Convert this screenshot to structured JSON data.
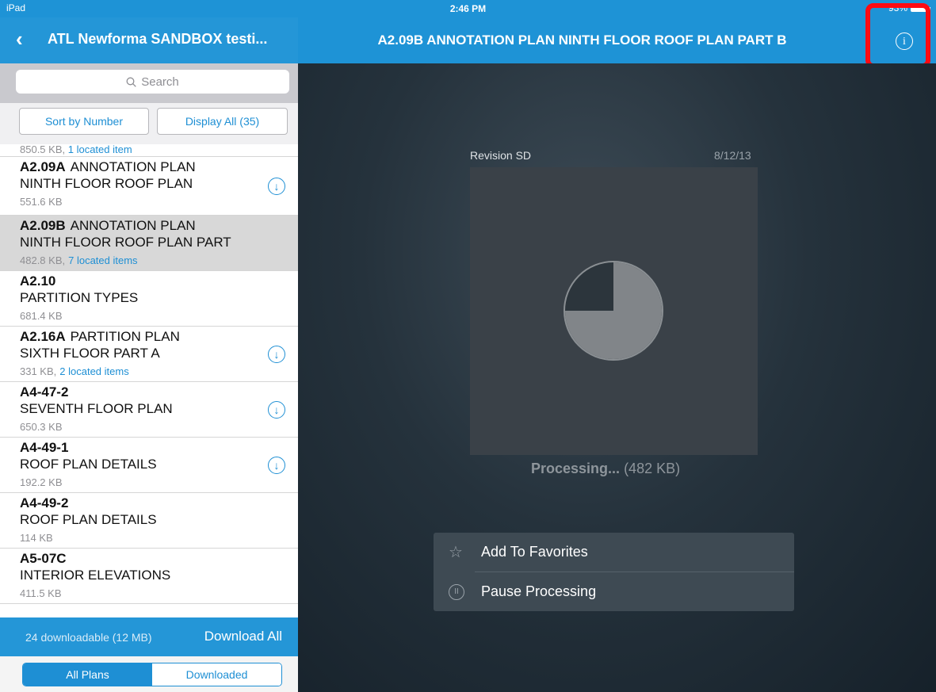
{
  "status": {
    "carrier": "iPad",
    "time": "2:46 PM",
    "battery": "93%"
  },
  "nav": {
    "back_icon": "chevron-left-icon",
    "project_title": "ATL Newforma SANDBOX testi...",
    "sheet_title": "A2.09B ANNOTATION PLAN NINTH FLOOR ROOF PLAN PART B",
    "info_icon": "i"
  },
  "search": {
    "placeholder": "Search"
  },
  "filters": {
    "sort_label": "Sort by Number",
    "display_label": "Display All (35)"
  },
  "list": {
    "partial_meta": {
      "size": "850.5 KB,",
      "located": "1 located item"
    },
    "items": [
      {
        "code": "A2.09A",
        "name_line1": "ANNOTATION PLAN",
        "name_line2": "NINTH FLOOR ROOF PLAN",
        "size": "551.6 KB",
        "located": "",
        "download": true,
        "selected": false
      },
      {
        "code": "A2.09B",
        "name_line1": "ANNOTATION PLAN",
        "name_line2": "NINTH FLOOR ROOF PLAN PART",
        "size": "482.8 KB,",
        "located": "7 located items",
        "download": false,
        "selected": true
      },
      {
        "code": "A2.10",
        "name_line1": "",
        "name_line2": "PARTITION TYPES",
        "size": "681.4 KB",
        "located": "",
        "download": false,
        "selected": false
      },
      {
        "code": "A2.16A",
        "name_line1": "PARTITION PLAN",
        "name_line2": "SIXTH FLOOR PART A",
        "size": "331 KB,",
        "located": "2 located items",
        "download": true,
        "selected": false
      },
      {
        "code": "A4-47-2",
        "name_line1": "",
        "name_line2": "SEVENTH FLOOR PLAN",
        "size": "650.3 KB",
        "located": "",
        "download": true,
        "selected": false
      },
      {
        "code": "A4-49-1",
        "name_line1": "",
        "name_line2": "ROOF PLAN DETAILS",
        "size": "192.2 KB",
        "located": "",
        "download": true,
        "selected": false
      },
      {
        "code": "A4-49-2",
        "name_line1": "",
        "name_line2": "ROOF PLAN DETAILS",
        "size": "114 KB",
        "located": "",
        "download": false,
        "selected": false
      },
      {
        "code": "A5-07C",
        "name_line1": "",
        "name_line2": "INTERIOR ELEVATIONS",
        "size": "411.5 KB",
        "located": "",
        "download": false,
        "selected": false
      }
    ]
  },
  "footer": {
    "downloadable": "24 downloadable (12 MB)",
    "download_all": "Download All"
  },
  "segments": {
    "all_plans": "All Plans",
    "downloaded": "Downloaded"
  },
  "preview": {
    "revision": "Revision SD",
    "date": "8/12/13",
    "status_bold": "Processing...",
    "status_size": "(482 KB)",
    "progress_fraction": 0.75
  },
  "actions": {
    "favorite_label": "Add To Favorites",
    "favorite_icon": "star-icon",
    "pause_label": "Pause Processing",
    "pause_icon": "pause-icon"
  }
}
